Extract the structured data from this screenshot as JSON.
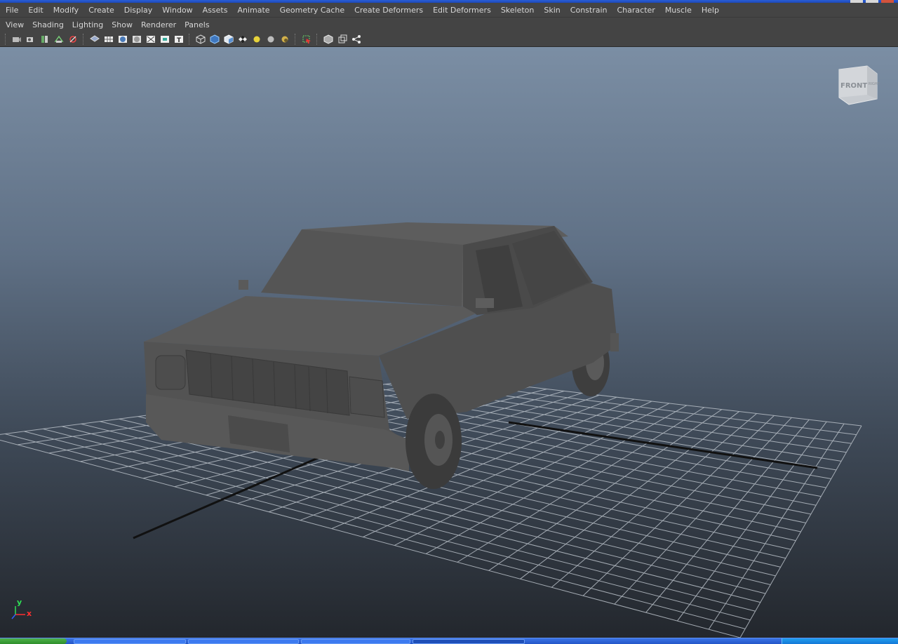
{
  "main_menu": [
    "File",
    "Edit",
    "Modify",
    "Create",
    "Display",
    "Window",
    "Assets",
    "Animate",
    "Geometry Cache",
    "Create Deformers",
    "Edit Deformers",
    "Skeleton",
    "Skin",
    "Constrain",
    "Character",
    "Muscle",
    "Help"
  ],
  "panel_menu": [
    "View",
    "Shading",
    "Lighting",
    "Show",
    "Renderer",
    "Panels"
  ],
  "toolbar_icons": [
    "select-camera-icon",
    "camera-attributes-icon",
    "bookmark-icon",
    "image-plane-icon",
    "xray-icon",
    "wireframe-icon",
    "grid-display-icon",
    "smooth-shade-icon",
    "shade-all-icon",
    "isolate-icon",
    "resolution-gate-icon",
    "text-icon",
    "wireframe-cube-icon",
    "shaded-cube-icon",
    "textured-cube-icon",
    "checker-icon",
    "default-light-icon",
    "all-lights-icon",
    "shadow-icon",
    "select-objects-icon",
    "bounding-box-icon",
    "backface-icon",
    "share-icon"
  ],
  "viewcube": {
    "front_label": "FRONT",
    "right_label": "RIGHT"
  },
  "axis": {
    "y_label": "y",
    "x_label": "x"
  },
  "colors": {
    "viewport_top": "#7b8ea4",
    "viewport_bottom": "#23272d",
    "grid": "#b9c0c8",
    "car": "#575757"
  }
}
